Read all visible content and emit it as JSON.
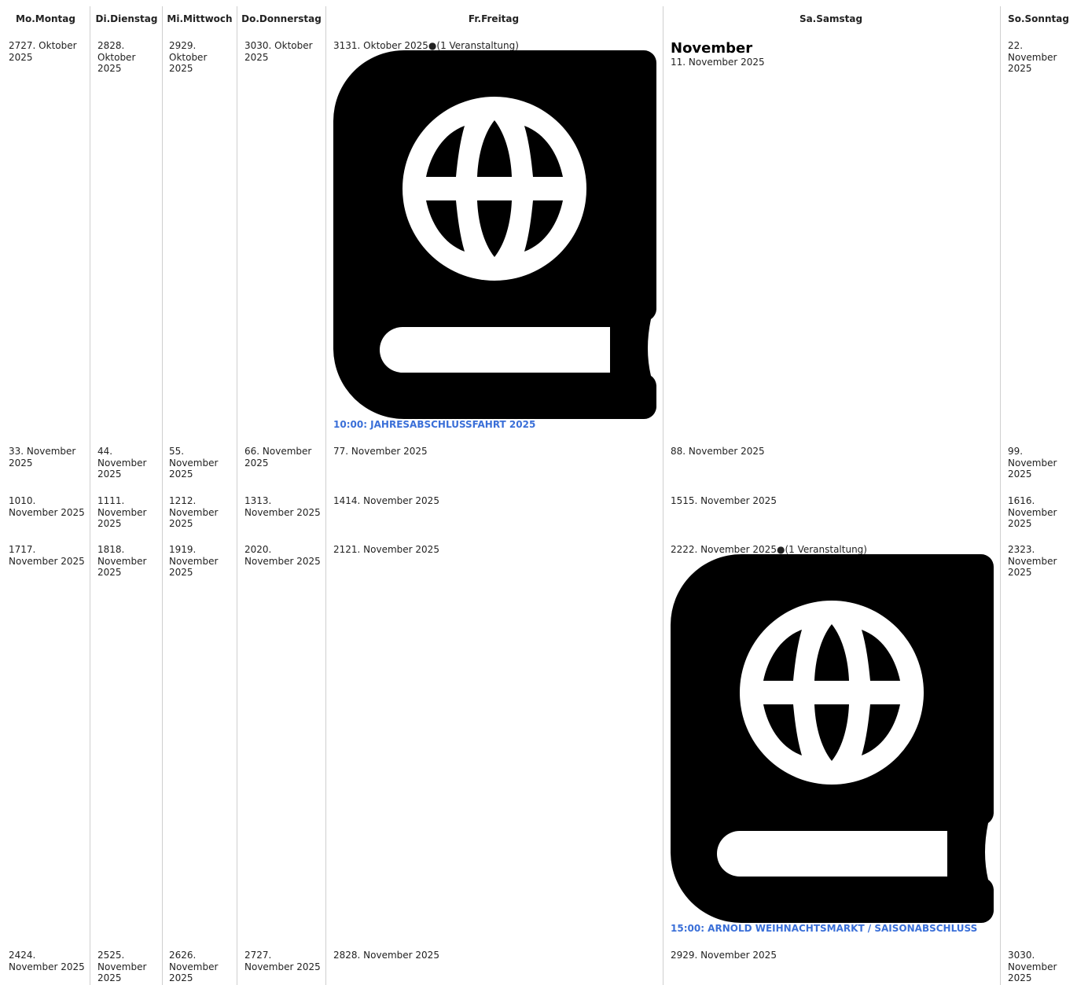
{
  "headers": [
    "Mo.Montag",
    "Di.Dienstag",
    "Mi.Mittwoch",
    "Do.Donnerstag",
    "Fr.Freitag",
    "Sa.Samstag",
    "So.Sonntag"
  ],
  "month_label": "November",
  "weeks": [
    [
      "2727. Oktober 2025",
      "2828. Oktober 2025",
      "2929. Oktober 2025",
      "3030. Oktober 2025",
      "3131. Oktober 2025",
      "11. November 2025",
      "22. November 2025"
    ],
    [
      "33. November 2025",
      "44. November 2025",
      "55. November 2025",
      "66. November 2025",
      "77. November 2025",
      "88. November 2025",
      "99. November 2025"
    ],
    [
      "1010. November 2025",
      "1111. November 2025",
      "1212. November 2025",
      "1313. November 2025",
      "1414. November 2025",
      "1515. November 2025",
      "1616. November 2025"
    ],
    [
      "1717. November 2025",
      "1818. November 2025",
      "1919. November 2025",
      "2020. November 2025",
      "2121. November 2025",
      "2222. November 2025",
      "2323. November 2025"
    ],
    [
      "2424. November 2025",
      "2525. November 2025",
      "2626. November 2025",
      "2727. November 2025",
      "2828. November 2025",
      "2929. November 2025",
      "3030. November 2025"
    ]
  ],
  "event_count_label": "(1 Veranstaltung)",
  "event_dot": "●",
  "events": [
    {
      "title": "10:00: JAHRESABSCHLUSSFAHRT 2025",
      "icon": "passport-globe-icon"
    },
    {
      "title": "15:00: ARNOLD WEIHNACHTSMARKT / SAISONABSCHLUSS",
      "icon": "passport-globe-icon"
    }
  ],
  "colors": {
    "event_link": "#3a6fd8",
    "grid_line": "#cfcfcf"
  }
}
